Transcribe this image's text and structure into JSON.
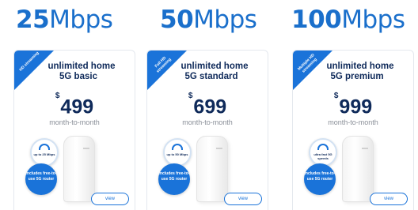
{
  "plans": [
    {
      "speed_number": "25",
      "speed_unit": "Mbps",
      "ribbon": "HD streaming",
      "name_line1": "unlimited home",
      "name_line2": "5G basic",
      "currency": "$",
      "price": "499",
      "term": "month-to-month",
      "speed_badge": "up to 25 Mbps",
      "router_badge": "includes free-to-use 5G router",
      "view_label": "view"
    },
    {
      "speed_number": "50",
      "speed_unit": "Mbps",
      "ribbon": "Full HD streaming",
      "name_line1": "unlimited home",
      "name_line2": "5G standard",
      "currency": "$",
      "price": "699",
      "term": "month-to-month",
      "speed_badge": "up to 50 Mbps",
      "router_badge": "includes free-to-use 5G router",
      "view_label": "view"
    },
    {
      "speed_number": "100",
      "speed_unit": "Mbps",
      "ribbon": "Multiple HD streaming",
      "name_line1": "unlimited home",
      "name_line2": "5G premium",
      "currency": "$",
      "price": "999",
      "term": "month-to-month",
      "speed_badge": "ultra fast 5G speeds",
      "router_badge": "includes free-to-use 5G router",
      "view_label": "view"
    }
  ],
  "colors": {
    "brand_blue": "#1a73d9",
    "heading_blue": "#1a6fcb",
    "navy_text": "#0f2a5a",
    "muted_text": "#8a8f98"
  }
}
